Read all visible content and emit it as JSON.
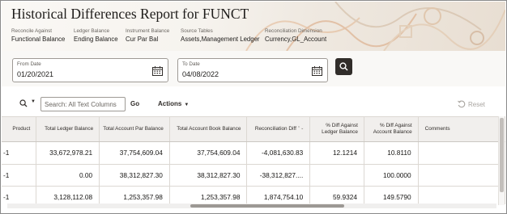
{
  "page": {
    "title": "Historical Differences Report for FUNCT"
  },
  "meta": [
    {
      "label": "Reconcile Against",
      "value": "Functional Balance"
    },
    {
      "label": "Ledger Balance",
      "value": "Ending Balance"
    },
    {
      "label": "Instrument Balance",
      "value": "Cur Par Bal"
    },
    {
      "label": "Source Tables",
      "value": "Assets,Management Ledger"
    },
    {
      "label": "Reconciliation Dimension",
      "value": "Currency,GL_Account"
    }
  ],
  "filters": {
    "from": {
      "label": "From Date",
      "value": "01/20/2021",
      "icon": "calendar-icon"
    },
    "to": {
      "label": "To Date",
      "value": "04/08/2022",
      "icon": "calendar-icon"
    },
    "search_icon": "search-icon"
  },
  "toolbar": {
    "search_placeholder": "Search: All Text Columns",
    "go_label": "Go",
    "actions_label": "Actions",
    "reset_label": "Reset"
  },
  "table": {
    "columns": [
      "Product",
      "Total Ledger Balance",
      "Total Account Par Balance",
      "Total Account Book Balance",
      "Reconciliation Diff",
      "% Diff Against Ledger Balance",
      "% Diff Against Account Balance",
      "Comments"
    ],
    "rows": [
      [
        "-1",
        "33,672,978.21",
        "37,754,609.04",
        "37,754,609.04",
        "-4,081,630.83",
        "12.1214",
        "10.8110",
        ""
      ],
      [
        "-1",
        "0.00",
        "38,312,827.30",
        "38,312,827.30",
        "-38,312,827....",
        "",
        "100.0000",
        ""
      ],
      [
        "-1",
        "3,128,112.08",
        "1,253,357.98",
        "1,253,357.98",
        "1,874,754.10",
        "59.9324",
        "149.5790",
        ""
      ]
    ]
  },
  "colors": {
    "header_bg": "#f6f3ee",
    "search_button_bg": "#312d2a",
    "table_header_bg": "#f1efed"
  }
}
